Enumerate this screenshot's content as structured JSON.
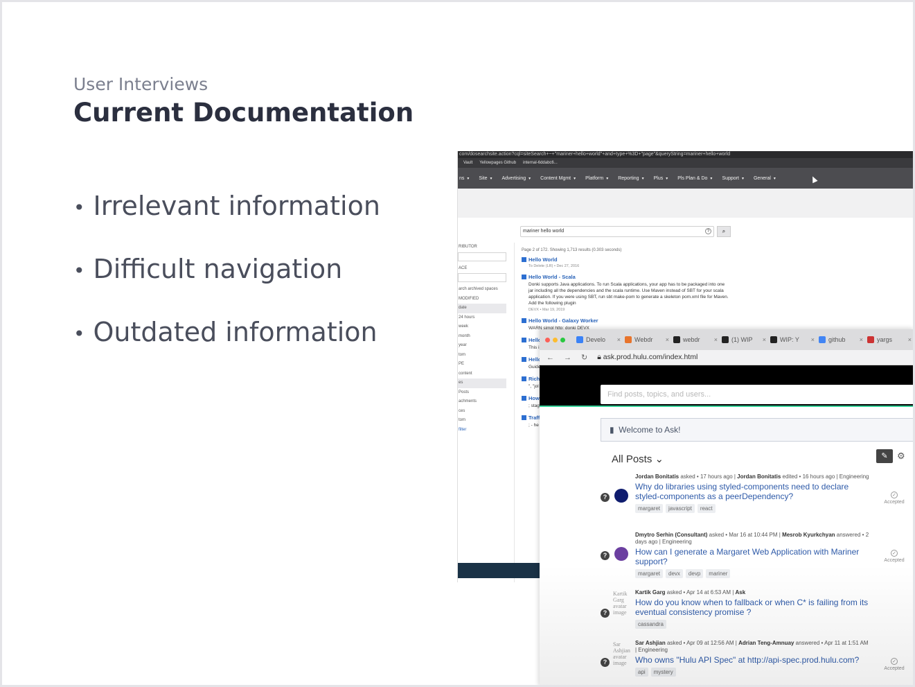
{
  "slide": {
    "eyebrow": "User Interviews",
    "title": "Current Documentation",
    "bullets": [
      "Irrelevant information",
      "Difficult navigation",
      "Outdated information"
    ]
  },
  "search_screenshot": {
    "url": "com/dosearchsite.action?cql=siteSearch+~+\"mariner+hello+world\"+and+type+%3D+\"page\"&queryString=mariner+hello+world",
    "bookmarks": [
      "Vault",
      "Yellowpages Github",
      "internal-6ddabc6..."
    ],
    "nav": [
      "ns",
      "Site",
      "Advertising",
      "Content Mgmt",
      "Platform",
      "Reporting",
      "Plus",
      "Pls Plan & Do",
      "Support",
      "General"
    ],
    "search_value": "mariner hello world",
    "results_meta": "Page 2 of 172. Showing 1,713 results (0.303 seconds)",
    "sidebar": [
      "RIBUTOR",
      "ACE",
      "arch archived spaces",
      "MODIFIED",
      "date",
      "24 hours",
      "week",
      "month",
      "year",
      "tom",
      "PE",
      "content",
      "es",
      "Posts",
      "achments",
      "ces",
      "tom",
      "filter"
    ],
    "results": [
      {
        "title": "Hello World",
        "sub": "To Delete (LR) • Dec 27, 2016",
        "desc": ""
      },
      {
        "title": "Hello World - Scala",
        "sub": "",
        "desc": "Donki supports Java applications. To run Scala applications, your app has to be packaged into one jar including all the dependencies and the scala runtime. Use Maven instead of SBT for your scala application. If you were using SBT, run sbt make-pom to generate a skeleton pom.xml file for Maven. Add the following plugin"
      },
      {
        "title": "",
        "sub": "DEVX • Mar 19, 2019",
        "desc": ""
      },
      {
        "title": "Hello World - Galaxy Worker",
        "sub": "",
        "desc": "WARN simpl http: donki DEVX"
      },
      {
        "title": "Hello",
        "sub": "",
        "desc": "This i steps move embe DEVX"
      },
      {
        "title": "Hello",
        "sub": "",
        "desc": "Guide here: https: DEVX"
      },
      {
        "title": "Rich",
        "sub": "",
        "desc": "\", \"jol world \"textL \"style Hulu F"
      },
      {
        "title": "How",
        "sub": "",
        "desc": "; stag folder the st consi Hulu F"
      },
      {
        "title": "Traffi",
        "sub": "",
        "desc": "; - he hmbi abc.h"
      }
    ]
  },
  "ask_screenshot": {
    "tabs": [
      {
        "label": "Develo",
        "color": "#3b82f6"
      },
      {
        "label": "Webdr",
        "color": "#e8742c"
      },
      {
        "label": "webdr",
        "color": "#222222"
      },
      {
        "label": "(1) WIP",
        "color": "#222222"
      },
      {
        "label": "WIP: Y",
        "color": "#222222"
      },
      {
        "label": "github",
        "color": "#4285f4"
      },
      {
        "label": "yargs",
        "color": "#cc3333"
      }
    ],
    "url": "ask.prod.hulu.com/index.html",
    "find_placeholder": "Find posts, topics, and users...",
    "welcome": "Welcome to Ask!",
    "all_posts": "All Posts",
    "posts": [
      {
        "meta_html": [
          "Jordan Bonitatis",
          " asked • 17 hours ago | ",
          "Jordan Bonitatis",
          " edited • 16 hours ago | Engineering"
        ],
        "title": "Why do libraries using styled-components need to declare styled-components as a peerDependency?",
        "tags": [
          "margaret",
          "javascript",
          "react"
        ],
        "status": "Accepted",
        "avatar_color": "#0f1c6e"
      },
      {
        "meta_html": [
          "Dmytro Serhin (Consultant)",
          " asked • Mar 16 at 10:44 PM | ",
          "Mesrob Kyurkchyan",
          " answered • 2 days ago | Engineering"
        ],
        "title": "How can I generate a Margaret Web Application with Mariner support?",
        "tags": [
          "margaret",
          "devx",
          "devp",
          "mariner"
        ],
        "status": "Accepted",
        "avatar_color": "#6b3fa0"
      },
      {
        "meta_html": [
          "Kartik Garg",
          " asked • Apr 14 at 6:53 AM | ",
          "Ask",
          ""
        ],
        "title": "How do you know when to fallback or when C* is failing from its eventual consistency promise ?",
        "tags": [
          "cassandra"
        ],
        "status": "",
        "avatar_alt": "Kartik Garg avatar image"
      },
      {
        "meta_html": [
          "Sar Ashjian",
          " asked • Apr 09 at 12:56 AM | ",
          "Adrian Teng-Amnuay",
          " answered • Apr 11 at 1:51 AM | Engineering"
        ],
        "title": "Who owns \"Hulu API Spec\" at http://api-spec.prod.hulu.com?",
        "tags": [
          "api",
          "mystery"
        ],
        "status": "Accepted",
        "avatar_alt": "Sar Ashjian avatar image"
      }
    ]
  }
}
